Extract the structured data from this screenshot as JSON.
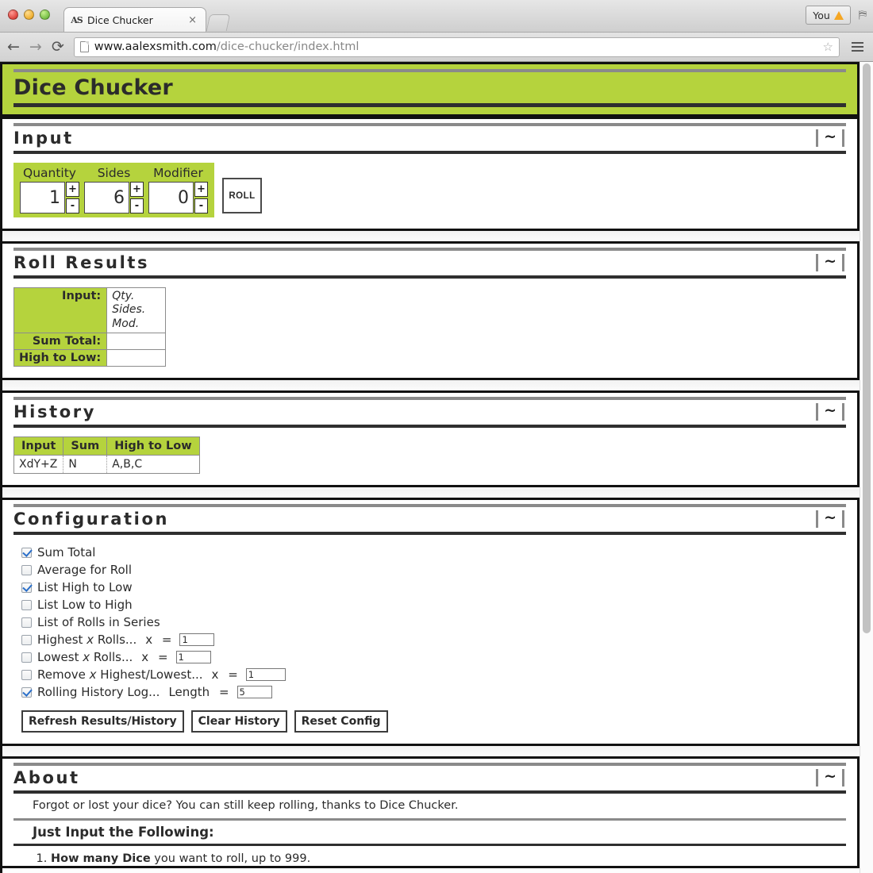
{
  "browser": {
    "tab": {
      "title": "Dice Chucker",
      "favicon": "AS",
      "close_label": "×"
    },
    "nav": {
      "back": "←",
      "forward": "→",
      "reload": "⟳"
    },
    "url": {
      "domain": "www.aalexsmith.com",
      "path": "/dice-chucker/index.html"
    },
    "bookmark_star": "☆",
    "profile": {
      "label": "You"
    },
    "new_tab_label": ""
  },
  "app": {
    "title": "Dice Chucker",
    "collapse_glyph": "~",
    "sections": {
      "input": {
        "title": "Input"
      },
      "results": {
        "title": "Roll Results"
      },
      "history": {
        "title": "History"
      },
      "config": {
        "title": "Configuration"
      },
      "about": {
        "title": "About"
      }
    }
  },
  "input_panel": {
    "fields": [
      {
        "label": "Quantity",
        "value": "1",
        "plus": "+",
        "minus": "-"
      },
      {
        "label": "Sides",
        "value": "6",
        "plus": "+",
        "minus": "-"
      },
      {
        "label": "Modifier",
        "value": "0",
        "plus": "+",
        "minus": "-"
      }
    ],
    "roll_button": "ROLL"
  },
  "results_panel": {
    "rows": [
      {
        "label": "Input:",
        "value_lines": [
          "Qty.",
          "Sides.",
          "Mod."
        ],
        "italic": true
      },
      {
        "label": "Sum Total:",
        "value_lines": [],
        "italic": false
      },
      {
        "label": "High to Low:",
        "value_lines": [],
        "italic": false
      }
    ],
    "placeholder_qty": "Qty.",
    "placeholder_sides": "Sides.",
    "placeholder_mod": "Mod."
  },
  "history_panel": {
    "columns": [
      "Input",
      "Sum",
      "High to Low"
    ],
    "rows": [
      [
        "XdY+Z",
        "N",
        "A,B,C"
      ]
    ]
  },
  "config_panel": {
    "options": [
      {
        "label": "Sum Total",
        "checked": true,
        "input": null
      },
      {
        "label": "Average for Roll",
        "checked": false,
        "input": null
      },
      {
        "label": "List High to Low",
        "checked": true,
        "input": null
      },
      {
        "label": "List Low to High",
        "checked": false,
        "input": null
      },
      {
        "label": "List of Rolls in Series",
        "checked": false,
        "input": null
      },
      {
        "label": "Highest x Rolls...",
        "checked": false,
        "input": {
          "var": "x",
          "value": "1"
        }
      },
      {
        "label": "Lowest x Rolls...",
        "checked": false,
        "input": {
          "var": "x",
          "value": "1"
        }
      },
      {
        "label": "Remove x Highest/Lowest...",
        "checked": false,
        "input": {
          "var": "x",
          "value": "1"
        }
      },
      {
        "label": "Rolling History Log...",
        "checked": true,
        "input": {
          "var": "Length",
          "value": "5"
        }
      }
    ],
    "buttons": [
      "Refresh Results/History",
      "Clear History",
      "Reset Config"
    ]
  },
  "about_panel": {
    "intro": "Forgot or lost your dice? You can still keep rolling, thanks to Dice Chucker.",
    "subheading": "Just Input the Following:",
    "items": [
      {
        "bold": "How many Dice",
        "rest": " you want to roll, up to 999."
      }
    ]
  },
  "colors": {
    "brand_green": "#b5d33d",
    "ink": "#2b2b2b",
    "rule_gray": "#8a8a8a",
    "rule_dark": "#2f2f2f",
    "check_blue": "#2a6fc9",
    "warn_orange": "#f5a623"
  }
}
